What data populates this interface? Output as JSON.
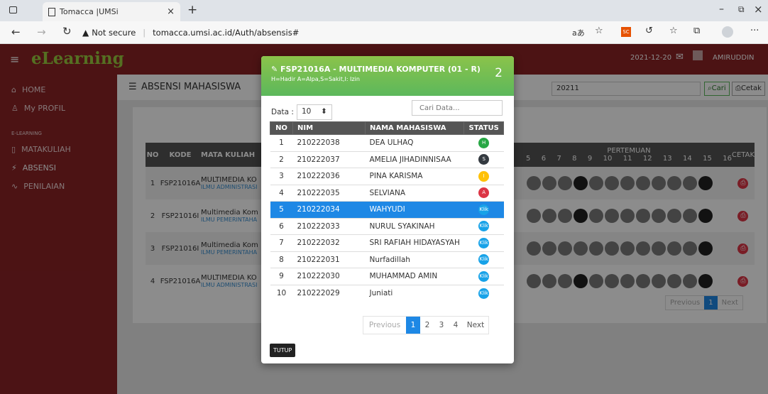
{
  "browser": {
    "tab_title": "Tomacca |UMSi",
    "security_label": "Not secure",
    "url": "tomacca.umsi.ac.id/Auth/absensis#"
  },
  "app": {
    "logo": "eLearning",
    "date": "2021-12-20",
    "user": "AMIRUDDIN"
  },
  "sidebar": {
    "items": [
      {
        "label": "HOME",
        "icon": "home-icon"
      },
      {
        "label": "My PROFIL",
        "icon": "user-icon"
      },
      {
        "label": "E-LEARNING",
        "icon": ""
      },
      {
        "label": "MATAKULIAH",
        "icon": "file-icon"
      },
      {
        "label": "ABSENSI",
        "icon": "pulse-icon"
      },
      {
        "label": "PENILAIAN",
        "icon": "activity-icon"
      }
    ]
  },
  "page": {
    "title": "ABSENSI MAHASISWA",
    "semester_value": "20211",
    "search_button": "Cari",
    "print_button": "Cetak",
    "pertemuan_header": "PERTEMUAN",
    "cetak_header": "CETAK",
    "previous": "Previous",
    "current_page": "1",
    "next": "Next",
    "columns": [
      "NO",
      "KODE",
      "MATA KULIAH"
    ],
    "meeting_numbers": [
      "5",
      "6",
      "7",
      "8",
      "9",
      "10",
      "11",
      "12",
      "13",
      "14",
      "15",
      "16"
    ],
    "rows": [
      {
        "no": "1",
        "kode": "FSP21016A",
        "mk": "MULTIMEDIA KO",
        "prodi": "ILMU ADMINISTRASI"
      },
      {
        "no": "2",
        "kode": "FSP21016I",
        "mk": "Multimedia Kom",
        "prodi": "ILMU PEMERINTAHA"
      },
      {
        "no": "3",
        "kode": "FSP21016I",
        "mk": "Multimedia Kom",
        "prodi": "ILMU PEMERINTAHA"
      },
      {
        "no": "4",
        "kode": "FSP21016A",
        "mk": "MULTIMEDIA KO",
        "prodi": "ILMU ADMINISTRASI"
      }
    ]
  },
  "modal": {
    "title": "FSP21016A - MULTIMEDIA KOMPUTER (01 - R)",
    "legend": "H=Hadir A=Alpa,S=Sakit,I: Izin",
    "meeting_number": "2",
    "data_label": "Data :",
    "data_count": "10",
    "search_placeholder": "Cari Data...",
    "columns": [
      "NO",
      "NIM",
      "NAMA MAHASISWA",
      "STATUS"
    ],
    "students": [
      {
        "no": "1",
        "nim": "210222038",
        "name": "DEA ULHAQ",
        "status": "H",
        "color": "#28a745"
      },
      {
        "no": "2",
        "nim": "210222037",
        "name": "AMELIA JIHADINNISAA",
        "status": "S",
        "color": "#343a40"
      },
      {
        "no": "3",
        "nim": "210222036",
        "name": "PINA KARISMA",
        "status": "I",
        "color": "#ffc107"
      },
      {
        "no": "4",
        "nim": "210222035",
        "name": "SELVIANA",
        "status": "A",
        "color": "#dc3545"
      },
      {
        "no": "5",
        "nim": "210222034",
        "name": "WAHYUDI",
        "status": "Klik",
        "color": "#17a2e8"
      },
      {
        "no": "6",
        "nim": "210222033",
        "name": "NURUL SYAKINAH",
        "status": "Klik",
        "color": "#17a2e8"
      },
      {
        "no": "7",
        "nim": "210222032",
        "name": "SRI RAFIAH HIDAYASYAH",
        "status": "Klik",
        "color": "#17a2e8"
      },
      {
        "no": "8",
        "nim": "210222031",
        "name": "Nurfadillah",
        "status": "Klik",
        "color": "#17a2e8"
      },
      {
        "no": "9",
        "nim": "210222030",
        "name": "MUHAMMAD AMIN",
        "status": "Klik",
        "color": "#17a2e8"
      },
      {
        "no": "10",
        "nim": "210222029",
        "name": "Juniati",
        "status": "Klik",
        "color": "#17a2e8"
      }
    ],
    "pagination": {
      "previous": "Previous",
      "pages": [
        "1",
        "2",
        "3",
        "4"
      ],
      "next": "Next"
    },
    "close_button": "TUTUP"
  }
}
